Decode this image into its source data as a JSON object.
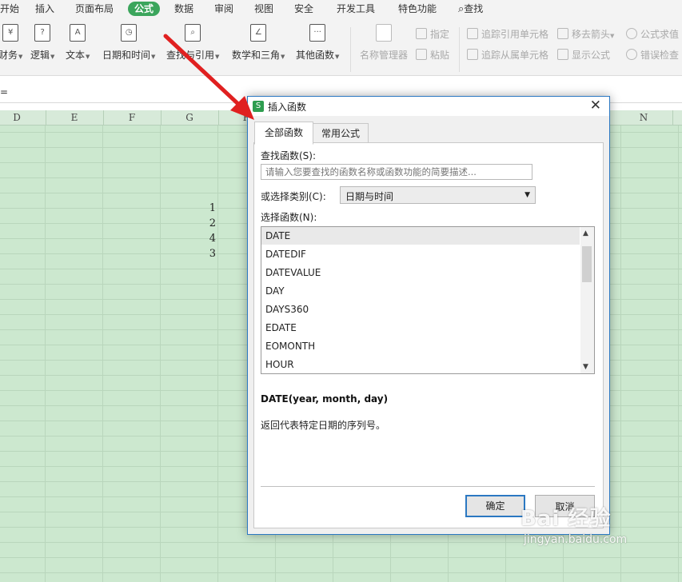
{
  "menu": [
    {
      "label": "开始"
    },
    {
      "label": "插入"
    },
    {
      "label": "页面布局"
    },
    {
      "label": "公式",
      "active": true
    },
    {
      "label": "数据"
    },
    {
      "label": "审阅"
    },
    {
      "label": "视图"
    },
    {
      "label": "安全"
    },
    {
      "label": "开发工具"
    },
    {
      "label": "特色功能"
    },
    {
      "label": "查找",
      "icon": "search-icon"
    }
  ],
  "ribbon": {
    "buttons": [
      {
        "label": "财务",
        "icon": "finance-icon",
        "glyph": "¥"
      },
      {
        "label": "逻辑",
        "icon": "logic-icon",
        "glyph": "?"
      },
      {
        "label": "文本",
        "icon": "text-icon",
        "glyph": "A"
      },
      {
        "label": "日期和时间",
        "icon": "clock-icon",
        "glyph": "◷"
      },
      {
        "label": "查找与引用",
        "icon": "lookup-icon",
        "glyph": "⌕"
      },
      {
        "label": "数学和三角",
        "icon": "math-icon",
        "glyph": "∠"
      },
      {
        "label": "其他函数",
        "icon": "more-functions-icon",
        "glyph": "···"
      }
    ],
    "name_manager": "名称管理器",
    "specify": "指定",
    "paste": "粘贴",
    "trace_precedents": "追踪引用单元格",
    "trace_dependents": "追踪从属单元格",
    "remove_arrows": "移去箭头",
    "show_formulas": "显示公式",
    "evaluate_formula": "公式求值",
    "error_check": "错误检查"
  },
  "formula_bar": {
    "text": "="
  },
  "sheet": {
    "columns": [
      "D",
      "E",
      "F",
      "G",
      "H",
      "N"
    ],
    "values": [
      "1",
      "2",
      "4",
      "3"
    ]
  },
  "dialog": {
    "title": "插入函数",
    "app_icon": "S",
    "close": "✕",
    "tabs": [
      {
        "label": "全部函数",
        "active": true
      },
      {
        "label": "常用公式"
      }
    ],
    "search_label": "查找函数(S):",
    "search_placeholder": "请输入您要查找的函数名称或函数功能的简要描述...",
    "category_label": "或选择类别(C):",
    "category_value": "日期与时间",
    "list_label": "选择函数(N):",
    "functions": [
      "DATE",
      "DATEDIF",
      "DATEVALUE",
      "DAY",
      "DAYS360",
      "EDATE",
      "EOMONTH",
      "HOUR"
    ],
    "selected_function": "DATE",
    "signature": "DATE(year, month, day)",
    "description": "返回代表特定日期的序列号。",
    "ok": "确定",
    "cancel": "取消"
  },
  "watermark": {
    "main": "Bai 经验",
    "sub": "jingyan.baidu.com"
  },
  "colors": {
    "menu_active": "#3ba55c",
    "sheet_bg": "#cce8cf",
    "dialog_border": "#2b78c2",
    "arrow": "#e02020"
  }
}
